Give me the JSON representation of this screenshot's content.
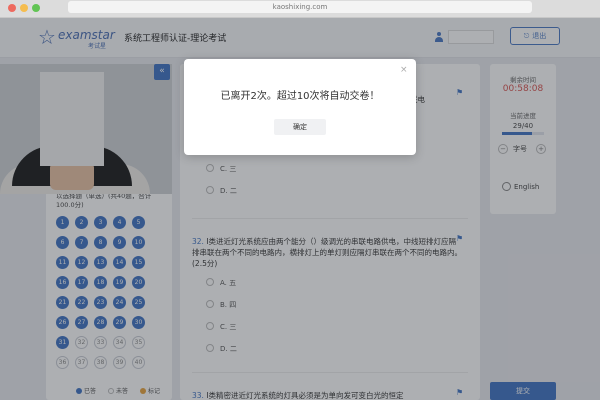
{
  "browser": {
    "url": "kaoshixing.com"
  },
  "header": {
    "logo_text": "examstar",
    "logo_sub": "考试星",
    "exam_title": "系统工程师认证-理论考试",
    "exit_label": "退出",
    "exit_icon": "exit-icon"
  },
  "left_panel": {
    "instructions": "以选择题（单选）(共40题，合计100.0分)",
    "questions": [
      {
        "n": "1",
        "state": "done"
      },
      {
        "n": "2",
        "state": "done"
      },
      {
        "n": "3",
        "state": "done"
      },
      {
        "n": "4",
        "state": "done"
      },
      {
        "n": "5",
        "state": "done"
      },
      {
        "n": "6",
        "state": "done"
      },
      {
        "n": "7",
        "state": "done"
      },
      {
        "n": "8",
        "state": "done"
      },
      {
        "n": "9",
        "state": "done"
      },
      {
        "n": "10",
        "state": "done"
      },
      {
        "n": "11",
        "state": "done"
      },
      {
        "n": "12",
        "state": "done"
      },
      {
        "n": "13",
        "state": "done"
      },
      {
        "n": "14",
        "state": "done"
      },
      {
        "n": "15",
        "state": "done"
      },
      {
        "n": "16",
        "state": "done"
      },
      {
        "n": "17",
        "state": "done"
      },
      {
        "n": "18",
        "state": "done"
      },
      {
        "n": "19",
        "state": "done"
      },
      {
        "n": "20",
        "state": "done"
      },
      {
        "n": "21",
        "state": "done"
      },
      {
        "n": "22",
        "state": "done"
      },
      {
        "n": "23",
        "state": "done"
      },
      {
        "n": "24",
        "state": "done"
      },
      {
        "n": "25",
        "state": "done"
      },
      {
        "n": "26",
        "state": "done"
      },
      {
        "n": "27",
        "state": "done"
      },
      {
        "n": "28",
        "state": "done"
      },
      {
        "n": "29",
        "state": "done"
      },
      {
        "n": "30",
        "state": "done"
      },
      {
        "n": "31",
        "state": "done"
      },
      {
        "n": "32",
        "state": "todo"
      },
      {
        "n": "33",
        "state": "todo"
      },
      {
        "n": "34",
        "state": "todo"
      },
      {
        "n": "35",
        "state": "todo"
      },
      {
        "n": "36",
        "state": "todo"
      },
      {
        "n": "37",
        "state": "todo"
      },
      {
        "n": "38",
        "state": "todo"
      },
      {
        "n": "39",
        "state": "todo"
      },
      {
        "n": "40",
        "state": "todo"
      }
    ],
    "legend": [
      {
        "label": "已答",
        "color": "#3f73c3"
      },
      {
        "label": "未答",
        "color": "#ffffff"
      },
      {
        "label": "标记",
        "color": "#e8a33d"
      }
    ]
  },
  "main": {
    "q31_options": [
      {
        "label": "C. 三"
      },
      {
        "label": "D. 二"
      }
    ],
    "q31_partial": "联电",
    "q32": {
      "number": "32.",
      "text": "I类进近灯光系统应由两个能分（）级调光的串联电路供电，中线短排灯应隔排串联在两个不同的电路内，横排灯上的单灯则应隔灯串联在两个不同的电路内。(2.5分)",
      "options": [
        {
          "label": "A. 五"
        },
        {
          "label": "B. 四"
        },
        {
          "label": "C. 三"
        },
        {
          "label": "D. 二"
        }
      ]
    },
    "q33": {
      "number": "33.",
      "text": "I类精密进近灯光系统的灯具必须是为单向发可变白光的恒定"
    },
    "flag_icon": "flag-icon"
  },
  "right_panel": {
    "time_label": "剩余时间",
    "time_value": "00:58:08",
    "progress_label": "当前进度",
    "progress_text": "29/40",
    "progress_fraction": 0.725,
    "font_label": "字号",
    "font_minus": "−",
    "font_plus": "+",
    "language": "English",
    "submit_label": "提交"
  },
  "dialog": {
    "message": "已离开2次。超过10次将自动交卷！",
    "ok_label": "确定",
    "close_glyph": "×"
  },
  "colors": {
    "accent": "#3f73c3",
    "timer": "#d9534f"
  }
}
